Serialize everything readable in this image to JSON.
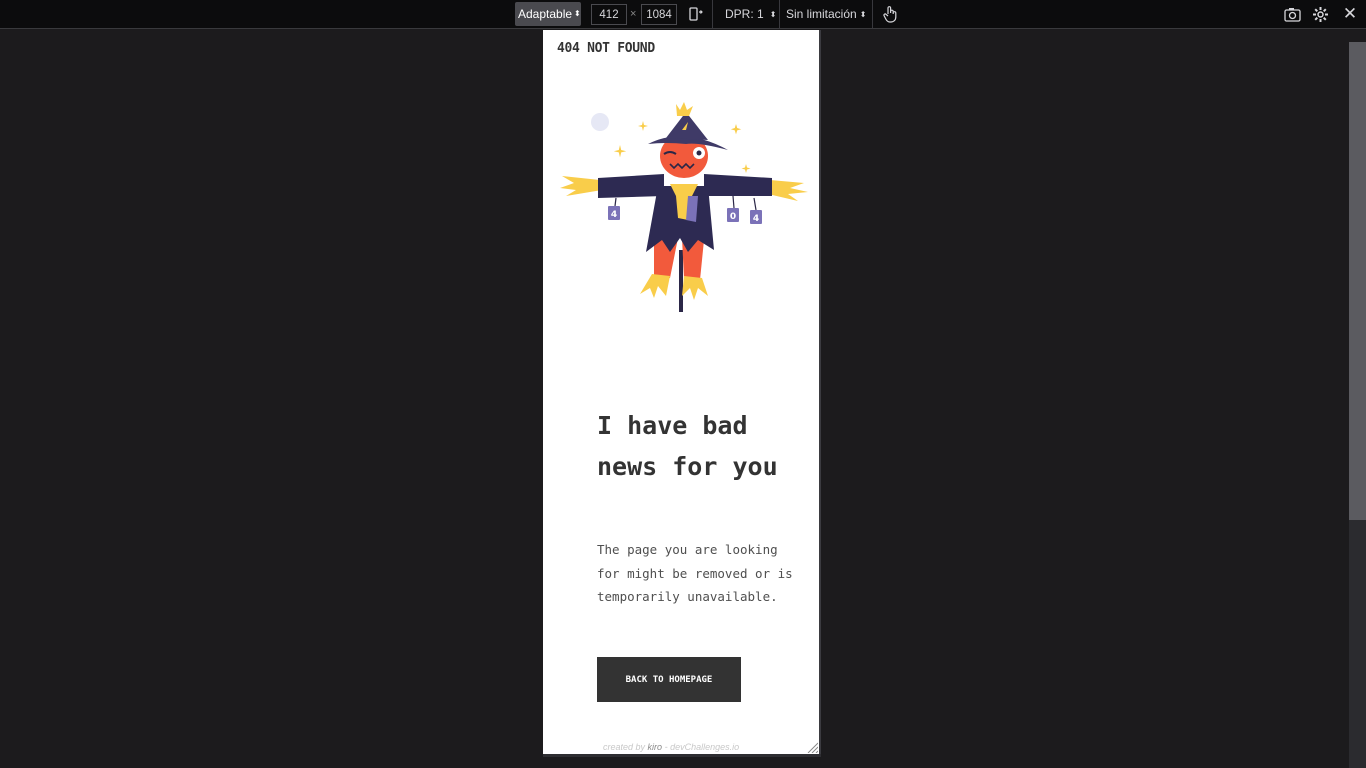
{
  "toolbar": {
    "device_label": "Adaptable",
    "width_value": "412",
    "times_sign": "×",
    "height_value": "1084",
    "dpr_label": "DPR: 1",
    "throttle_label": "Sin limitación"
  },
  "page": {
    "brand": "404 NOT FOUND",
    "headline": "I have bad news for you",
    "description": "The page you are looking for might be removed or is temporarily unavailable.",
    "button_label": "BACK TO HOMEPAGE",
    "credit_prefix": "created by",
    "credit_author": "kiro",
    "credit_suffix": "- devChallenges.io",
    "sign_labels": [
      "4",
      "0",
      "4"
    ]
  },
  "colors": {
    "toolbar_bg": "#0c0c0d",
    "backdrop": "#1c1b1d",
    "text_dark": "#333333",
    "hat_purple": "#3f3a67",
    "face_orange": "#f25a3c",
    "straw_yellow": "#f9cd4a"
  }
}
